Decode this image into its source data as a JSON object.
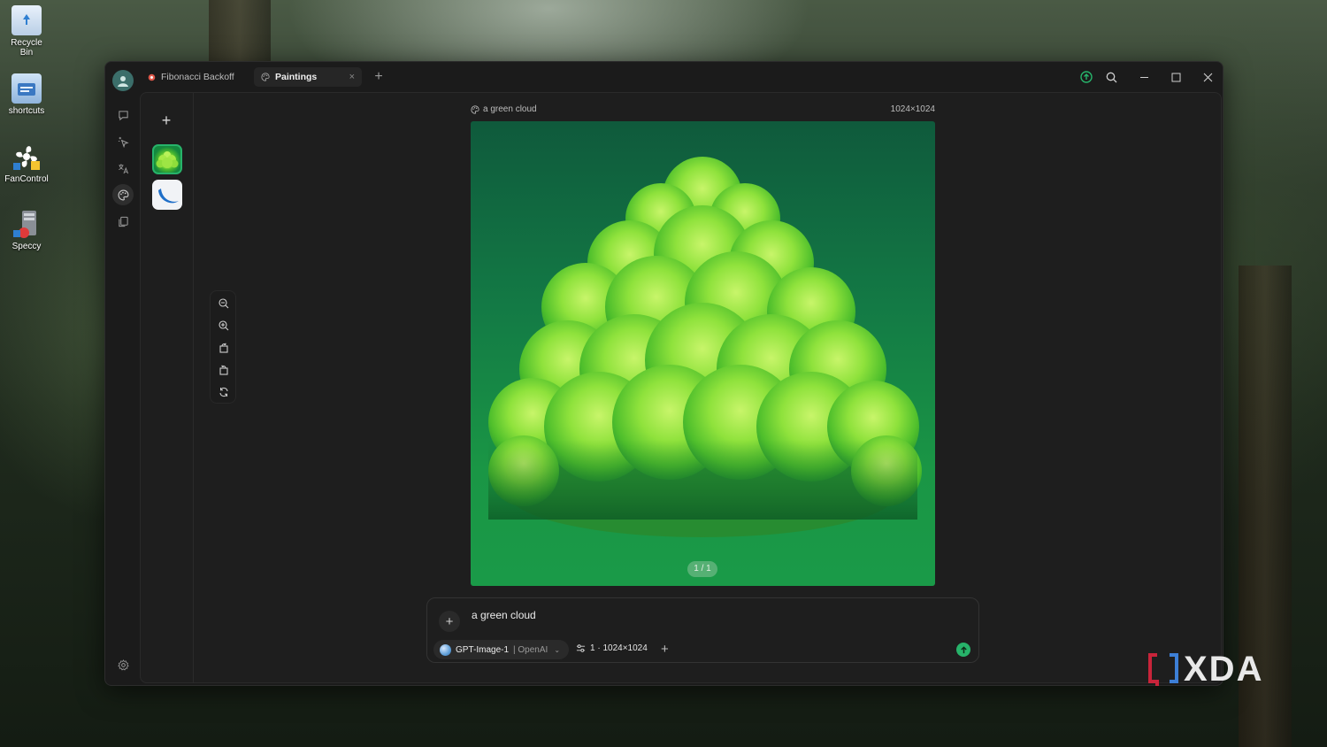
{
  "desktop": {
    "icons": [
      {
        "label": "Recycle Bin",
        "icon": "recycle-bin-icon"
      },
      {
        "label": "shortcuts",
        "icon": "folder-icon"
      },
      {
        "label": "FanControl",
        "icon": "fan-icon"
      },
      {
        "label": "Speccy",
        "icon": "speccy-icon"
      }
    ],
    "watermark": "XDA"
  },
  "titlebar": {
    "tabs": [
      {
        "label": "Fibonacci Backoff",
        "icon": "chat-dot-icon",
        "active": false
      },
      {
        "label": "Paintings",
        "icon": "palette-icon",
        "active": true,
        "close": "×"
      }
    ],
    "add_tab": "+"
  },
  "history": {
    "add": "+"
  },
  "painting": {
    "prompt": "a green cloud",
    "dimensions": "1024×1024",
    "pager": "1 / 1"
  },
  "input": {
    "add": "+",
    "text": "a green cloud",
    "model_name": "GPT-Image-1",
    "model_provider": "| OpenAI",
    "size_option": "1 · 1024×1024",
    "option_add": "+"
  },
  "colors": {
    "accent": "#27b36a",
    "window_bg": "#1b1b1b",
    "content_bg": "#1e1e1e"
  }
}
